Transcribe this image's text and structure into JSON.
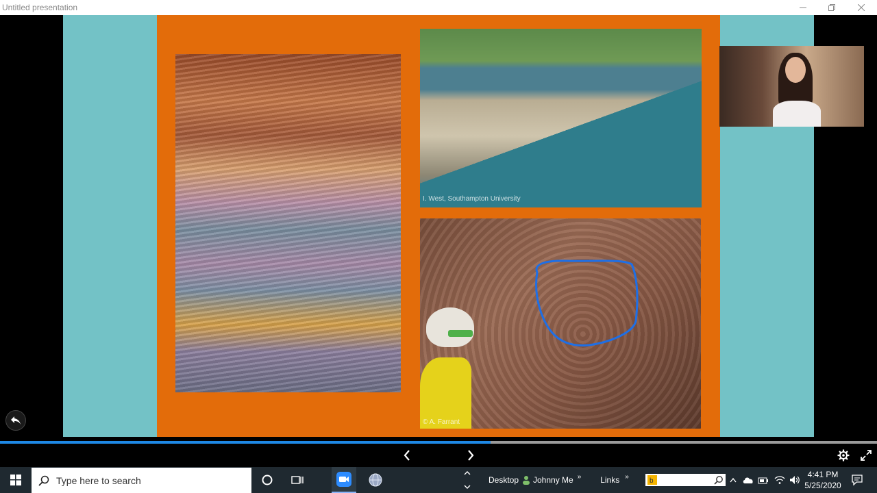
{
  "window": {
    "title": "Untitled presentation"
  },
  "slide": {
    "captions": {
      "cliff": "I. West, Southampton University",
      "cave": "© A. Farrant"
    },
    "annotation_color": "#1e6fe6",
    "background": "#e36c0a",
    "side_color": "#73c2c6"
  },
  "progress": {
    "fraction": 0.559
  },
  "taskbar": {
    "search_placeholder": "Type here to search",
    "desktop_label": "Desktop",
    "johnny_label": "Johnny Me",
    "links_label": "Links",
    "time": "4:41 PM",
    "date": "5/25/2020"
  }
}
